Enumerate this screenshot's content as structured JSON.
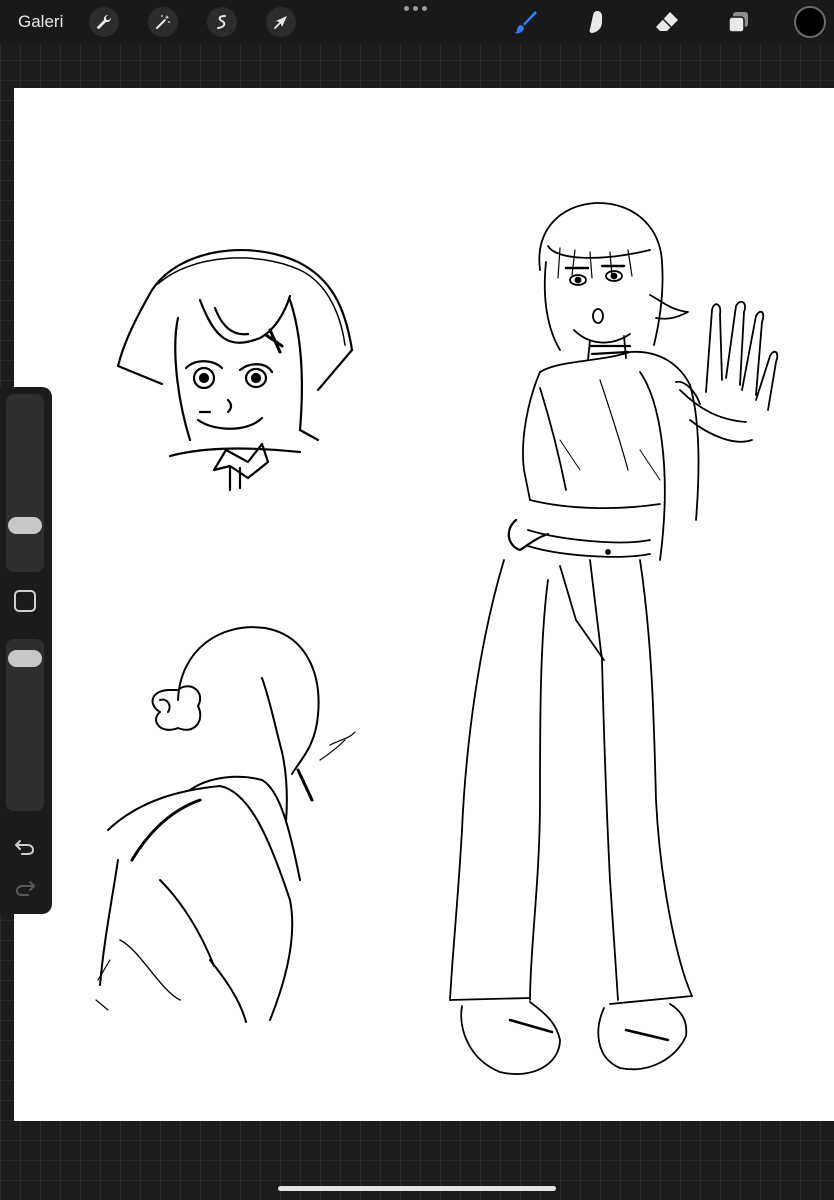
{
  "topbar": {
    "gallery_label": "Galeri",
    "left_tools": [
      "wrench-icon",
      "magic-wand-icon",
      "selection-icon",
      "transform-icon"
    ],
    "right_tools": [
      "brush-icon",
      "smudge-icon",
      "eraser-icon",
      "layers-icon"
    ],
    "active_tool": "brush-icon",
    "current_color": "#000000",
    "accent_color": "#2f7cf6"
  },
  "sidebar": {
    "brush_size_level": 0.22,
    "opacity_level": 0.95,
    "controls": [
      "brush-size-slider",
      "modify-button",
      "opacity-slider",
      "undo-button",
      "redo-button"
    ]
  }
}
